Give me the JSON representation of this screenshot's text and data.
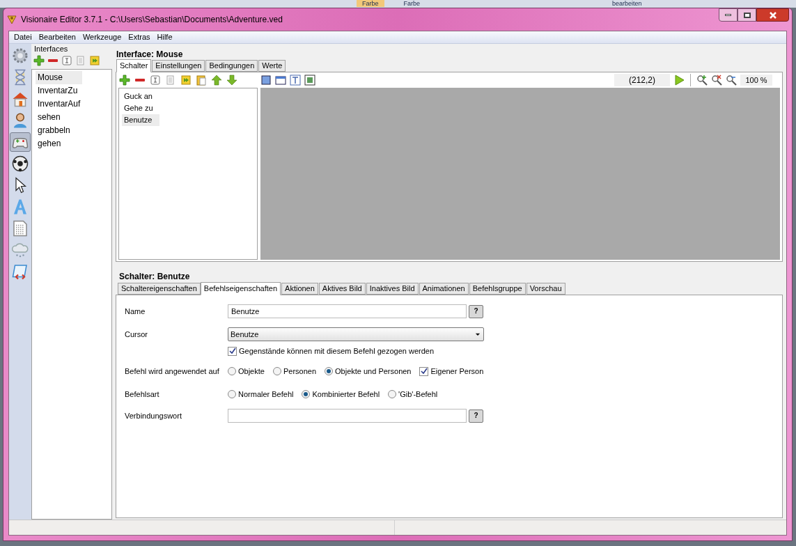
{
  "desktop_behind": {
    "texts": [
      "Farbe",
      "Farbe",
      "bearbeiten"
    ]
  },
  "window": {
    "title": "Visionaire Editor 3.7.1 - C:\\Users\\Sebastian\\Documents\\Adventure.ved"
  },
  "menu": [
    "Datei",
    "Bearbeiten",
    "Werkzeuge",
    "Extras",
    "Hilfe"
  ],
  "sidebar_tools": [
    {
      "kind": "gear",
      "selected": false
    },
    {
      "kind": "hourglass",
      "selected": false
    },
    {
      "kind": "house",
      "selected": false
    },
    {
      "kind": "person",
      "selected": false
    },
    {
      "kind": "gamepad",
      "selected": true
    },
    {
      "kind": "ball",
      "selected": false
    },
    {
      "kind": "cursor",
      "selected": false
    },
    {
      "kind": "letter",
      "selected": false
    },
    {
      "kind": "document",
      "selected": false
    },
    {
      "kind": "cloud",
      "selected": false
    },
    {
      "kind": "scroll",
      "selected": false
    }
  ],
  "interfaces_panel": {
    "title": "Interfaces",
    "items": [
      {
        "label": "Mouse",
        "selected": true
      },
      {
        "label": "InventarZu",
        "selected": false
      },
      {
        "label": "InventarAuf",
        "selected": false
      },
      {
        "label": "sehen",
        "selected": false
      },
      {
        "label": "grabbeln",
        "selected": false
      },
      {
        "label": "gehen",
        "selected": false
      }
    ]
  },
  "interface_header": "Interface: Mouse",
  "interface_tabs": [
    {
      "label": "Schalter",
      "selected": true
    },
    {
      "label": "Einstellungen",
      "selected": false
    },
    {
      "label": "Bedingungen",
      "selected": false
    },
    {
      "label": "Werte",
      "selected": false
    }
  ],
  "switches": [
    {
      "label": "Guck an",
      "selected": false
    },
    {
      "label": "Gehe zu",
      "selected": false
    },
    {
      "label": "Benutze",
      "selected": true
    }
  ],
  "canvas_toolbar": {
    "coords": "(212,2)",
    "zoom": "100 %"
  },
  "switch_header": "Schalter: Benutze",
  "switch_tabs": [
    {
      "label": "Schaltereigenschaften",
      "selected": false
    },
    {
      "label": "Befehlseigenschaften",
      "selected": true
    },
    {
      "label": "Aktionen",
      "selected": false
    },
    {
      "label": "Aktives Bild",
      "selected": false
    },
    {
      "label": "Inaktives Bild",
      "selected": false
    },
    {
      "label": "Animationen",
      "selected": false
    },
    {
      "label": "Befehlsgruppe",
      "selected": false
    },
    {
      "label": "Vorschau",
      "selected": false
    }
  ],
  "form": {
    "name_label": "Name",
    "name_value": "Benutze",
    "help_label": "?",
    "cursor_label": "Cursor",
    "cursor_value": "Benutze",
    "drag_option": {
      "label": "Gegenstände können mit diesem Befehl gezogen werden",
      "checked": true
    },
    "applies_label": "Befehl wird angewendet auf",
    "applies_options": [
      {
        "label": "Objekte",
        "selected": false
      },
      {
        "label": "Personen",
        "selected": false
      },
      {
        "label": "Objekte und Personen",
        "selected": true
      }
    ],
    "own_person": {
      "label": "Eigener Person",
      "checked": true
    },
    "type_label": "Befehlsart",
    "type_options": [
      {
        "label": "Normaler Befehl",
        "selected": false
      },
      {
        "label": "Kombinierter Befehl",
        "selected": true
      },
      {
        "label": "'Gib'-Befehl",
        "selected": false
      }
    ],
    "connector_label": "Verbindungswort",
    "connector_help_label": "?"
  }
}
